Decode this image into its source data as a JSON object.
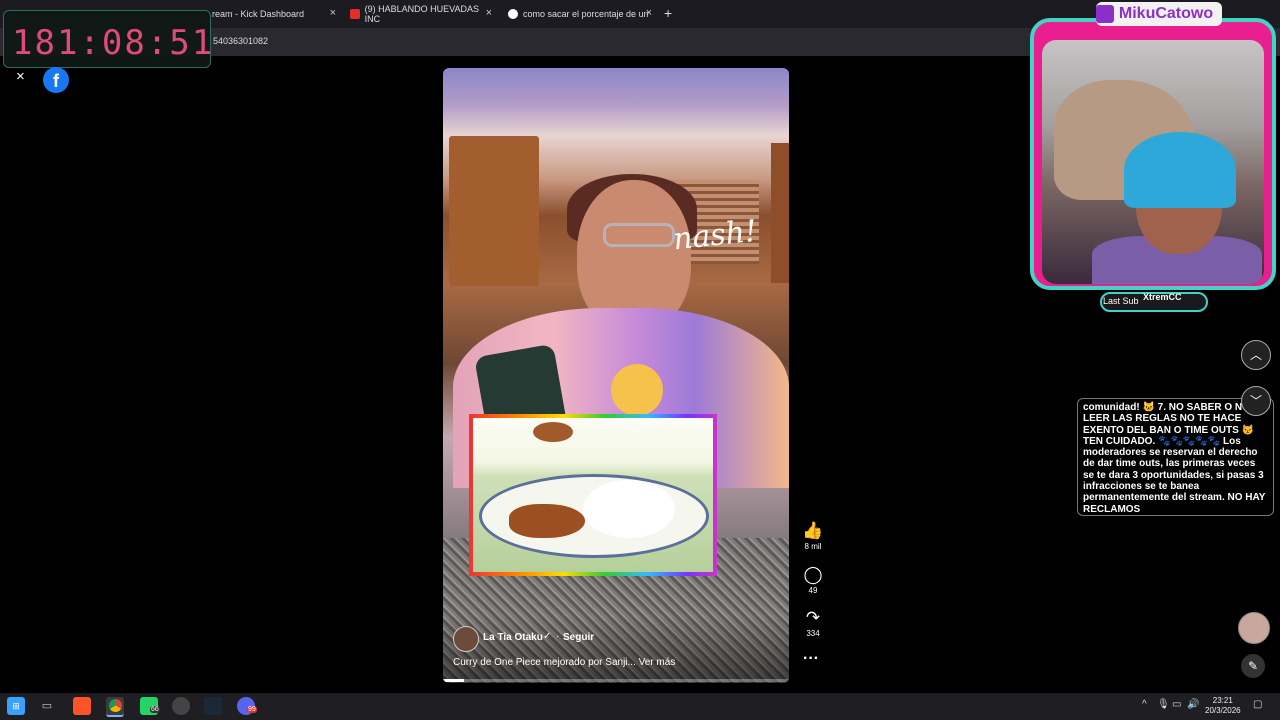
{
  "browser": {
    "tabs": [
      {
        "title": "ream - Kick Dashboard"
      },
      {
        "title": "(9) HABLANDO HUEVADAS INC"
      },
      {
        "title": "como sacar el porcentaje de un"
      }
    ],
    "new_tab": "+",
    "close": "×",
    "address": "54036301082"
  },
  "overlay": {
    "timer": "181:08:51",
    "webcam_title": "MikuCatowo",
    "last_sub_label": "Last Sub",
    "last_sub_name": "XtremCC"
  },
  "viewer": {
    "close": "×",
    "facebook": "f",
    "video": {
      "author": "La Tia Otaku",
      "verified": "✓",
      "separator": "·",
      "follow": "Seguir",
      "caption": "Curry de One Piece mejorado por Sanji... Ver más",
      "neon_sign": "nash!",
      "progress_fraction": 0.06
    },
    "actions": {
      "like_icon": "👍",
      "like_count": "8 mil",
      "comment_icon": "◯",
      "comment_count": "49",
      "share_icon": "↷",
      "share_count": "334",
      "more": "···"
    },
    "nav": {
      "up": "︿",
      "down": "﹀"
    }
  },
  "chat": {
    "text": "comunidad! 🐱 7. NO SABER O NO LEER LAS REGLAS NO TE HACE EXENTO DEL BAN O TIME OUTS 😾 TEN CUIDADO. 🐾🐾🐾🐾🐾 Los moderadores se reservan el derecho de dar time outs, las primeras veces se te dara 3 oportunidades, si pasas 3 infracciones se te banea permanentemente del stream. NO HAY RECLAMOS"
  },
  "taskbar": {
    "chrome_badge": "66",
    "discord_badge": "99",
    "time": "23:21",
    "date": "20/3/2026"
  },
  "colors": {
    "timer_digits": "#e04b79",
    "overlay_border": "#42d3c7",
    "overlay_frame": "#ea1f8f",
    "twitch_purple": "#8b2fc9",
    "facebook_blue": "#1877f2"
  }
}
